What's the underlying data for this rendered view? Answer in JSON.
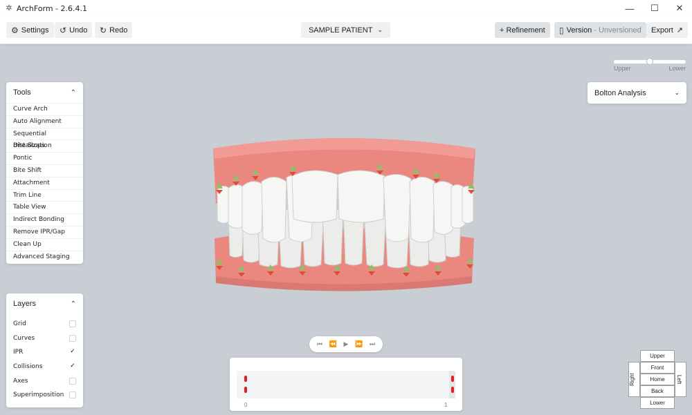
{
  "window": {
    "title": "ArchForm - 2.6.4.1"
  },
  "toolbar": {
    "settings": "Settings",
    "undo": "Undo",
    "redo": "Redo",
    "patient": "SAMPLE PATIENT",
    "refinement": "+ Refinement",
    "version_label": "Version",
    "version_state": "- Unversioned",
    "export": "Export"
  },
  "arch_slider": {
    "left_label": "Upper",
    "right_label": "Lower",
    "value": 0.5
  },
  "tools": {
    "title": "Tools",
    "items": [
      "Curve Arch",
      "Auto Alignment",
      "Sequential Distalization",
      "Bite Stops",
      "Pontic",
      "Bite Shift",
      "Attachment",
      "Trim Line",
      "Table View",
      "Indirect Bonding",
      "Remove IPR/Gap",
      "Clean Up",
      "Advanced Staging"
    ]
  },
  "layers": {
    "title": "Layers",
    "items": [
      {
        "label": "Grid",
        "checked": false
      },
      {
        "label": "Curves",
        "checked": false
      },
      {
        "label": "IPR",
        "checked": true
      },
      {
        "label": "Collisions",
        "checked": true
      },
      {
        "label": "Axes",
        "checked": false
      },
      {
        "label": "Superimposition",
        "checked": false
      }
    ]
  },
  "analysis": {
    "selected": "Bolton Analysis"
  },
  "timeline": {
    "start": "0",
    "end": "1"
  },
  "viewcube": {
    "upper": "Upper",
    "front": "Front",
    "home": "Home",
    "back": "Back",
    "lower": "Lower",
    "right": "Right",
    "left": "Left"
  },
  "colors": {
    "gum": "#e9857d",
    "tooth": "#f4f4f2",
    "accent_red": "#e02020",
    "background": "#c9ced4"
  }
}
